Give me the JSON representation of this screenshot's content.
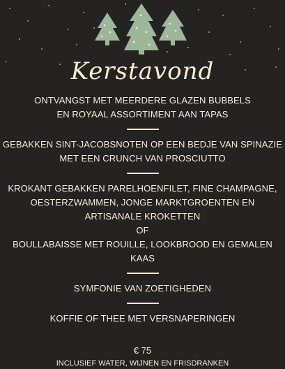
{
  "title": "Kerstavond",
  "courses": [
    {
      "lines": [
        "ONTVANGST MET MEERDERE GLAZEN BUBBELS",
        "EN ROYAAL ASSORTIMENT AAN TAPAS"
      ]
    },
    {
      "lines": [
        "GEBAKKEN SINT-JACOBSNOTEN OP EEN BEDJE VAN SPINAZIE",
        "MET EEN CRUNCH VAN PROSCIUTTO"
      ]
    },
    {
      "lines": [
        "KROKANT GEBAKKEN PARELHOENFILET, FINE CHAMPAGNE,",
        "OESTERZWAMMEN, JONGE MARKTGROENTEN EN",
        "ARTISANALE KROKETTEN",
        "OF",
        "BOULLABAISSE MET ROUILLE, LOOKBROOD EN GEMALEN",
        "KAAS"
      ]
    },
    {
      "lines": [
        "SYMFONIE VAN ZOETIGHEDEN"
      ]
    },
    {
      "lines": [
        "KOFFIE OF THEE MET VERSNAPERINGEN"
      ]
    }
  ],
  "price": "€ 75",
  "footnote": "INCLUSIEF WATER, WIJNEN EN FRISDRANKEN",
  "colors": {
    "background": "#242322",
    "text": "#f4ecd8",
    "tree": "#9db79a"
  },
  "icons": [
    "christmas-tree-icon",
    "snowflake-dots"
  ]
}
